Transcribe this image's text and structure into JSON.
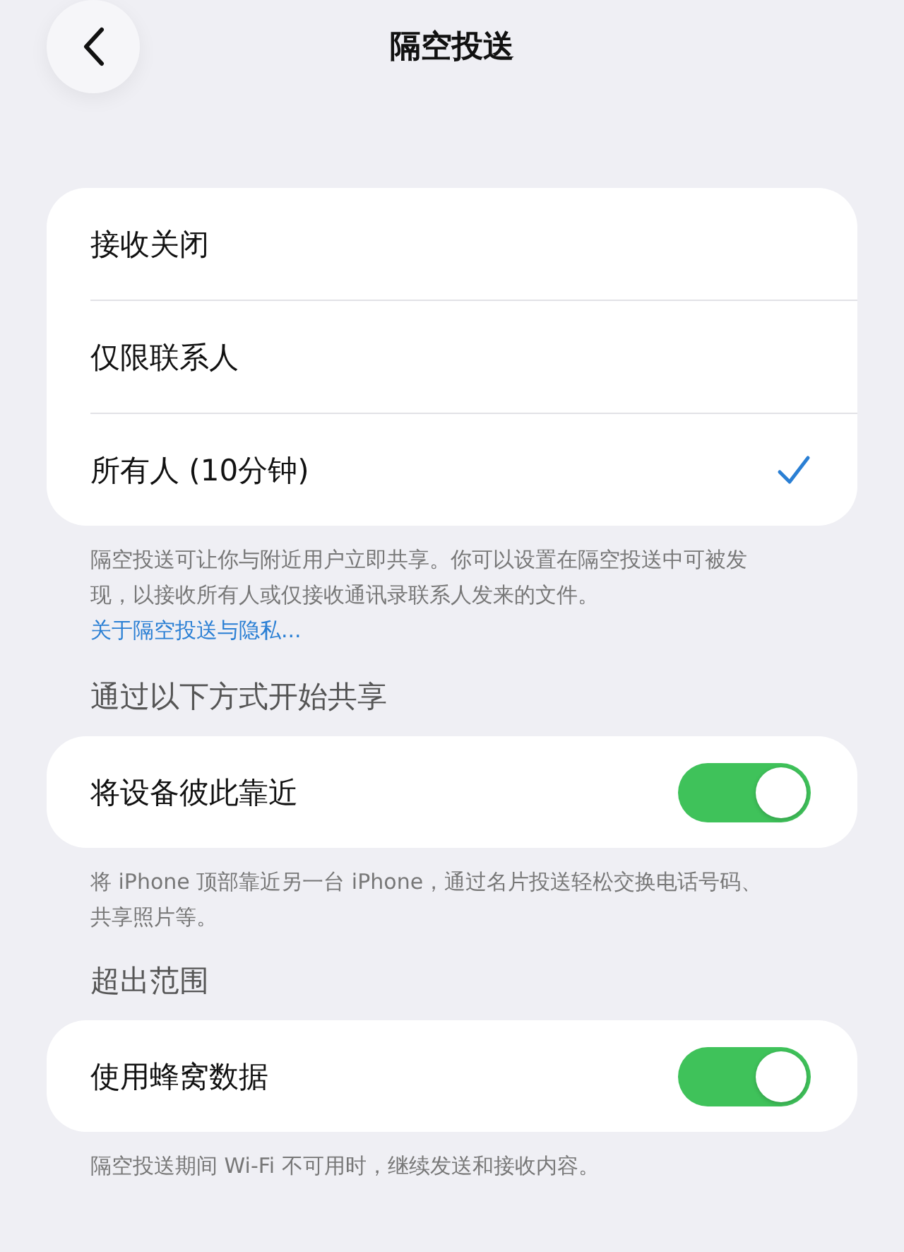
{
  "nav": {
    "title": "隔空投送"
  },
  "options": [
    {
      "label": "接收关闭",
      "selected": false
    },
    {
      "label": "仅限联系人",
      "selected": false
    },
    {
      "label": "所有人 (10分钟)",
      "selected": true
    }
  ],
  "options_footer": {
    "text": "隔空投送可让你与附近用户立即共享。你可以设置在隔空投送中可被发现，以接收所有人或仅接收通讯录联系人发来的文件。",
    "link": "关于隔空投送与隐私..."
  },
  "sections": [
    {
      "header": "通过以下方式开始共享",
      "label": "将设备彼此靠近",
      "on": true,
      "footer": "将 iPhone 顶部靠近另一台 iPhone，通过名片投送轻松交换电话号码、共享照片等。"
    },
    {
      "header": "超出范围",
      "label": "使用蜂窝数据",
      "on": true,
      "footer": "隔空投送期间 Wi-Fi 不可用时，继续发送和接收内容。"
    }
  ]
}
